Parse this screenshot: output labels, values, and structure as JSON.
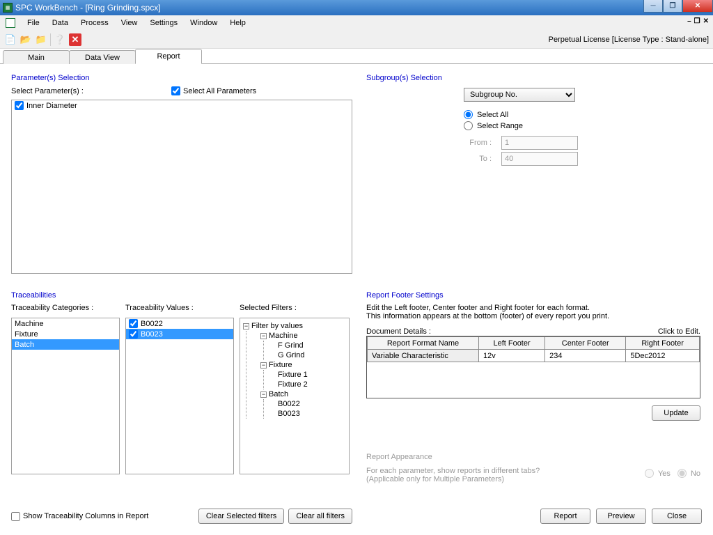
{
  "title": "SPC WorkBench - [Ring Grinding.spcx]",
  "menu": {
    "file": "File",
    "data": "Data",
    "process": "Process",
    "view": "View",
    "settings": "Settings",
    "window": "Window",
    "help": "Help"
  },
  "license": "Perpetual License [License Type : Stand-alone]",
  "tabs": {
    "main": "Main",
    "dataview": "Data View",
    "report": "Report"
  },
  "params": {
    "title": "Parameter(s) Selection",
    "selectLabel": "Select Parameter(s) :",
    "selectAll": "Select All Parameters",
    "items": [
      "Inner Diameter"
    ]
  },
  "subgroup": {
    "title": "Subgroup(s) Selection",
    "dropdown": "Subgroup No.",
    "selectAll": "Select All",
    "selectRange": "Select Range",
    "fromLabel": "From :",
    "from": "1",
    "toLabel": "To :",
    "to": "40"
  },
  "trace": {
    "title": "Traceabilities",
    "catLabel": "Traceability Categories :",
    "valLabel": "Traceability Values :",
    "filtLabel": "Selected Filters :",
    "categories": [
      "Machine",
      "Fixture",
      "Batch"
    ],
    "values": [
      "B0022",
      "B0023"
    ],
    "tree": {
      "root": "Filter by values",
      "machine": {
        "label": "Machine",
        "children": [
          "F Grind",
          "G Grind"
        ]
      },
      "fixture": {
        "label": "Fixture",
        "children": [
          "Fixture 1",
          "Fixture 2"
        ]
      },
      "batch": {
        "label": "Batch",
        "children": [
          "B0022",
          "B0023"
        ]
      }
    },
    "showCols": "Show Traceability Columns in Report",
    "clearSel": "Clear Selected filters",
    "clearAll": "Clear all filters"
  },
  "footer": {
    "title": "Report Footer Settings",
    "line1": "Edit the Left footer, Center footer and Right footer for each format.",
    "line2": "This information appears at the bottom (footer) of every report you print.",
    "docLabel": "Document Details :",
    "clickEdit": "Click to Edit.",
    "headers": {
      "name": "Report Format Name",
      "left": "Left Footer",
      "center": "Center Footer",
      "right": "Right Footer"
    },
    "row": {
      "name": "Variable Characteristic",
      "left": "12v",
      "center": "234",
      "right": "5Dec2012"
    },
    "update": "Update"
  },
  "appearance": {
    "title": "Report Appearance",
    "line1": "For each parameter, show reports in different tabs?",
    "line2": "(Applicable only for Multiple Parameters)",
    "yes": "Yes",
    "no": "No"
  },
  "buttons": {
    "report": "Report",
    "preview": "Preview",
    "close": "Close"
  }
}
